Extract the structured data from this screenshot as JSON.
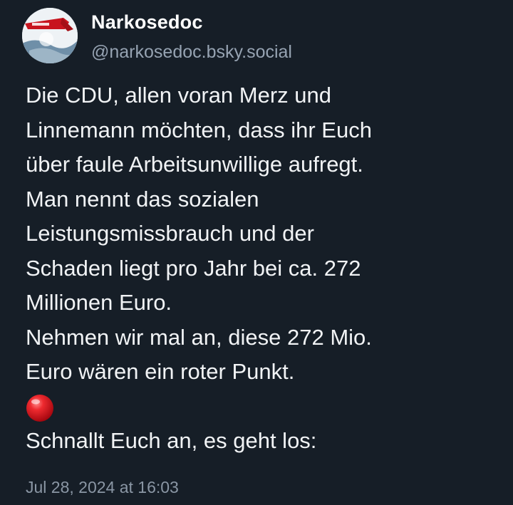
{
  "author": {
    "display_name": "Narkosedoc",
    "handle": "@narkosedoc.bsky.social",
    "avatar_icon": "avatar-image"
  },
  "post": {
    "lines": [
      "Die CDU, allen voran Merz und",
      "Linnemann möchten, dass ihr Euch",
      "über faule Arbeitsunwillige aufregt.",
      "Man nennt das sozialen",
      "Leistungsmissbrauch und der",
      "Schaden liegt pro Jahr bei ca. 272",
      "Millionen Euro.",
      "Nehmen wir mal an, diese 272 Mio.",
      "Euro wären ein roter Punkt."
    ],
    "emoji_icon": "red-circle-emoji",
    "final_line": "Schnallt Euch an, es geht los:"
  },
  "timestamp": "Jul 28, 2024 at 16:03",
  "colors": {
    "background": "#161e27",
    "text": "#f1f3f5",
    "handle": "#96a3b2",
    "timestamp": "#8a96a4",
    "emoji_red": "#e01020"
  }
}
